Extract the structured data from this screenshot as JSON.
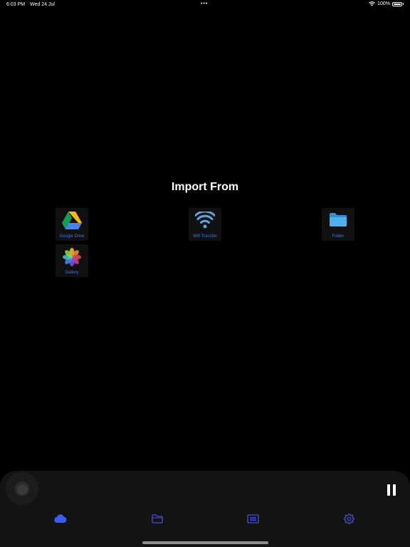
{
  "status_bar": {
    "time": "6:03 PM",
    "date": "Wed 24 Jul",
    "dots": "•••",
    "battery": "100%"
  },
  "import_screen": {
    "title": "Import From",
    "options": [
      {
        "label": "Google Drive",
        "icon": "google-drive-icon"
      },
      {
        "label": "Wifi Transfer",
        "icon": "wifi-icon"
      },
      {
        "label": "Folder",
        "icon": "folder-icon"
      },
      {
        "label": "Gallery",
        "icon": "gallery-icon"
      }
    ]
  },
  "bottom_nav": {
    "items": [
      {
        "icon": "cloud-icon",
        "active": true
      },
      {
        "icon": "folder-icon",
        "active": false
      },
      {
        "icon": "document-list-icon",
        "active": false
      },
      {
        "icon": "gear-icon",
        "active": false
      }
    ]
  },
  "colors": {
    "background": "#000000",
    "tile_background": "#101010",
    "label_blue": "#3a7bd5",
    "active_nav": "#3b5bff",
    "inactive_nav": "#3f51d9",
    "panel": "#131313"
  }
}
